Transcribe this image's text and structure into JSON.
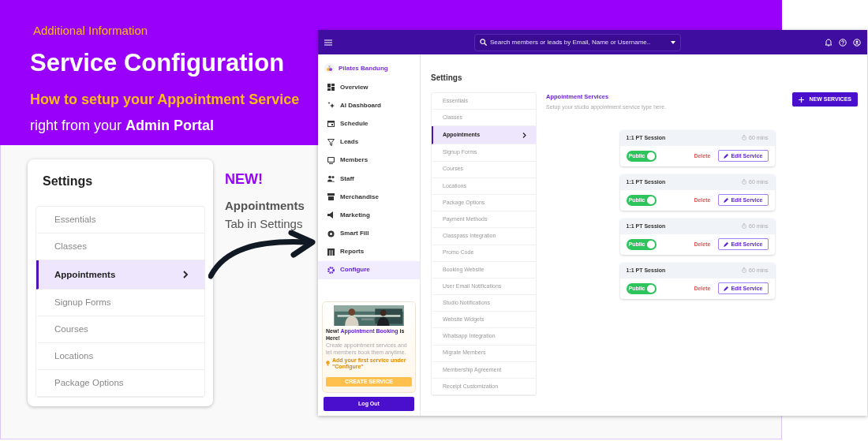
{
  "banner": {
    "eyebrow": "Additional Information",
    "title": "Service Configuration",
    "subtitle": "How to setup your Appointment Service",
    "tagline": "right from your **Admin Portal**"
  },
  "callout": {
    "badge": "NEW!",
    "heading": "Appointments",
    "text": "Tab in Settings"
  },
  "settings_card": {
    "title": "Settings",
    "items": [
      {
        "label": "Essentials",
        "selected": false
      },
      {
        "label": "Classes",
        "selected": false
      },
      {
        "label": "Appointments",
        "selected": true
      },
      {
        "label": "Signup Forms",
        "selected": false
      },
      {
        "label": "Courses",
        "selected": false
      },
      {
        "label": "Locations",
        "selected": false
      },
      {
        "label": "Package Options",
        "selected": false
      }
    ]
  },
  "app": {
    "search": {
      "placeholder": "Search members or leads by Email, Name or Username.."
    },
    "brand": "Pilates Bandung",
    "nav": [
      {
        "label": "Overview",
        "selected": false
      },
      {
        "label": "AI Dashboard",
        "selected": false
      },
      {
        "label": "Schedule",
        "selected": false
      },
      {
        "label": "Leads",
        "selected": false
      },
      {
        "label": "Members",
        "selected": false
      },
      {
        "label": "Staff",
        "selected": false
      },
      {
        "label": "Merchandise",
        "selected": false
      },
      {
        "label": "Marketing",
        "selected": false
      },
      {
        "label": "Smart Fill",
        "selected": false
      },
      {
        "label": "Reports",
        "selected": false
      },
      {
        "label": "Configure",
        "selected": true
      }
    ],
    "promo": {
      "kind": "picture",
      "title_start": "New!",
      "title_link": "Appointment Booking",
      "title_end": "is Here!",
      "text": "Create appointment services and let members book them anytime.",
      "hint": "Add your first service under \"Configure\"",
      "button": "CREATE SERVICE"
    },
    "logout": "Log Out",
    "page_title": "Settings",
    "settings": [
      {
        "label": "Essentials",
        "selected": false
      },
      {
        "label": "Classes",
        "selected": false
      },
      {
        "label": "Appointments",
        "selected": true
      },
      {
        "label": "Signup Forms",
        "selected": false
      },
      {
        "label": "Courses",
        "selected": false
      },
      {
        "label": "Locations",
        "selected": false
      },
      {
        "label": "Package Options",
        "selected": false
      },
      {
        "label": "Payment Methods",
        "selected": false
      },
      {
        "label": "Classpass Integration",
        "selected": false
      },
      {
        "label": "Promo Code",
        "selected": false
      },
      {
        "label": "Booking Website",
        "selected": false
      },
      {
        "label": "User Email Notifications",
        "selected": false
      },
      {
        "label": "Studio Notifications",
        "selected": false
      },
      {
        "label": "Website Widgets",
        "selected": false
      },
      {
        "label": "Whatsapp Integration",
        "selected": false
      },
      {
        "label": "Migrate Members",
        "selected": false
      },
      {
        "label": "Membership Agreement",
        "selected": false
      },
      {
        "label": "Receipt Customization",
        "selected": false
      }
    ],
    "section": {
      "title": "Appointment Services",
      "description": "Setup your studio appointment service type here.",
      "new_button": "NEW SERVICES"
    },
    "services": [
      {
        "name": "1:1 PT Session",
        "duration": "60 mins",
        "public": true,
        "visibility": "Public",
        "delete": "Delete",
        "edit": "Edit Service"
      },
      {
        "name": "1:1 PT Session",
        "duration": "60 mins",
        "public": true,
        "visibility": "Public",
        "delete": "Delete",
        "edit": "Edit Service"
      },
      {
        "name": "1:1 PT Session",
        "duration": "60 mins",
        "public": true,
        "visibility": "Public",
        "delete": "Delete",
        "edit": "Edit Service"
      },
      {
        "name": "1:1 PT Session",
        "duration": "60 mins",
        "public": true,
        "visibility": "Public",
        "delete": "Delete",
        "edit": "Edit Service"
      }
    ]
  }
}
